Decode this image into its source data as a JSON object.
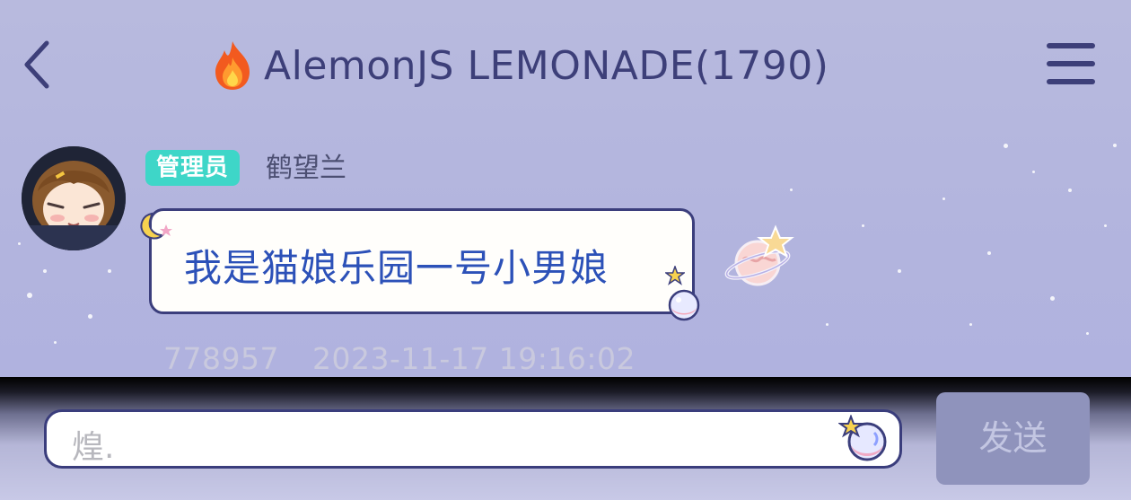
{
  "header": {
    "title": "AlemonJS LEMONADE(1790)"
  },
  "message": {
    "role_badge": "管理员",
    "sender": "鹤望兰",
    "text": "我是猫娘乐园一号小男娘",
    "id": "778957",
    "timestamp": "2023-11-17 19:16:02"
  },
  "composer": {
    "input_value": "煌.",
    "send_label": "发送"
  },
  "colors": {
    "accent": "#3d3f79",
    "badge": "#3ed6c8",
    "message_text": "#2c51b8",
    "send_button": "#8f93bc"
  },
  "icons": [
    "back-icon",
    "fire-icon",
    "menu-icon",
    "avatar",
    "moon-icon",
    "star-icon",
    "orb-icon",
    "planet-sticker-icon"
  ]
}
